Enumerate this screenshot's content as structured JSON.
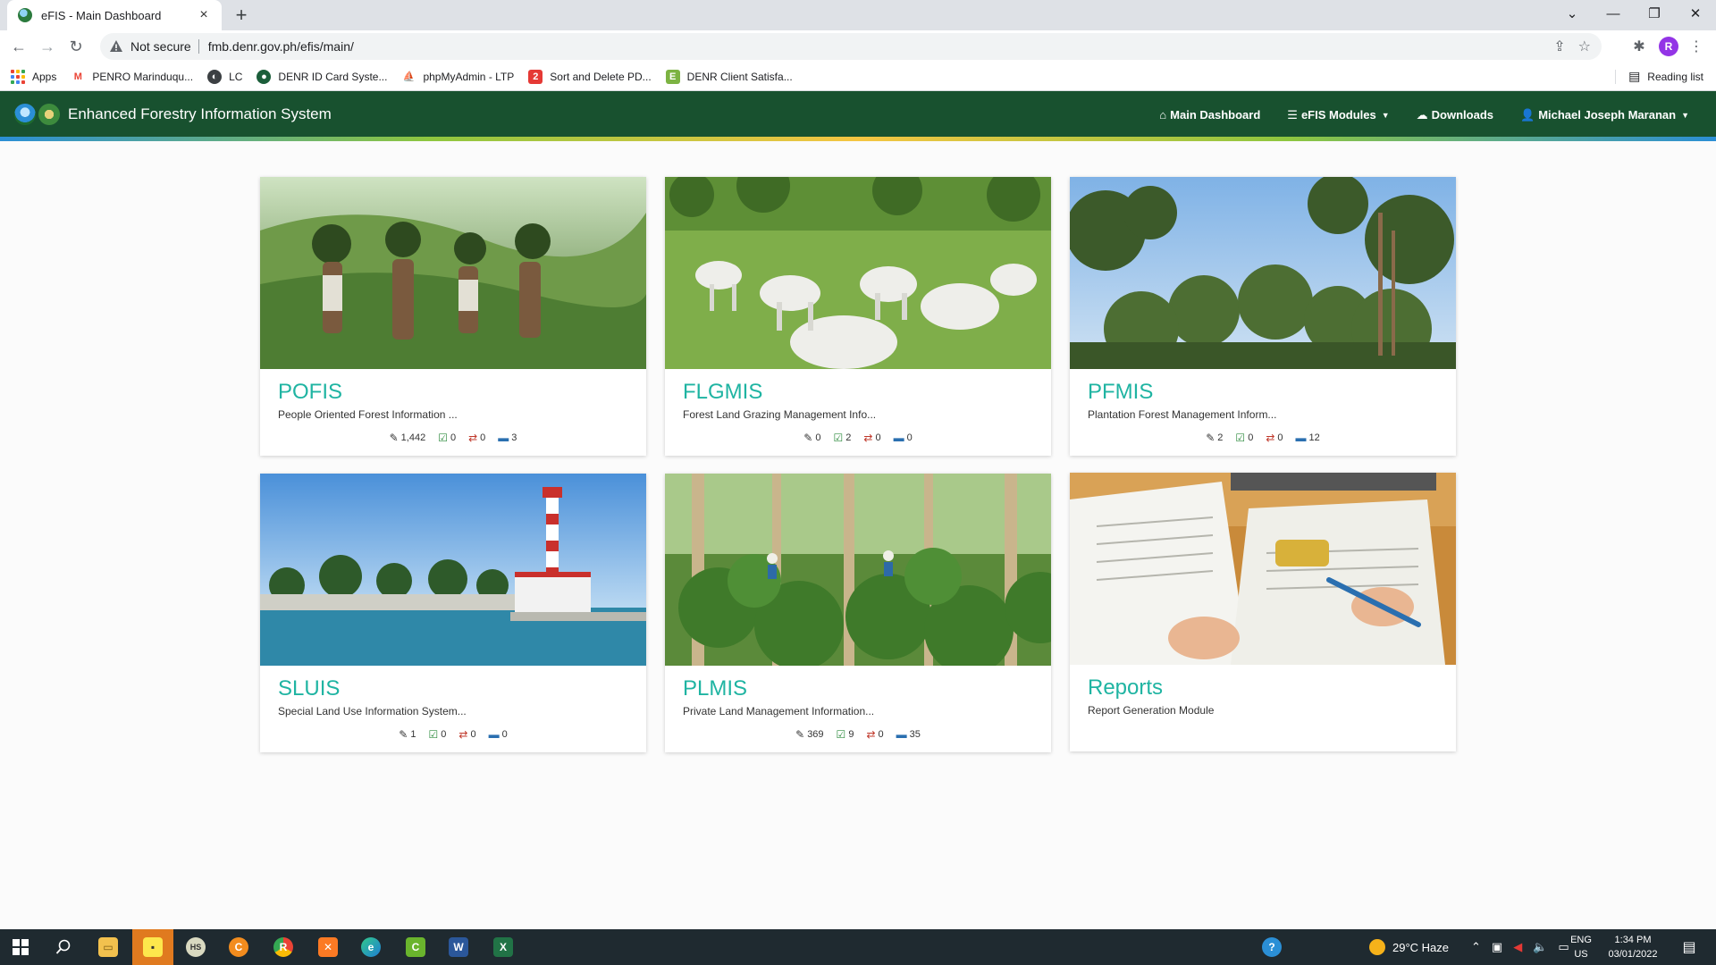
{
  "browser": {
    "tab_title": "eFIS - Main Dashboard",
    "tab_close": "×",
    "new_tab": "+",
    "security_label": "Not secure",
    "url": "fmb.denr.gov.ph/efis/main/",
    "profile_initial": "R",
    "reading_list": "Reading list",
    "icons": [
      "back-icon",
      "forward-icon",
      "reload-icon",
      "share-icon",
      "star-icon",
      "extensions-icon",
      "menu-icon"
    ]
  },
  "bookmarks": [
    {
      "label": "Apps",
      "icon": "apps-icon"
    },
    {
      "label": "PENRO Marinduqu...",
      "icon": "gmail-icon"
    },
    {
      "label": "LC",
      "icon": "lc-icon"
    },
    {
      "label": "DENR ID Card Syste...",
      "icon": "denr-icon"
    },
    {
      "label": "phpMyAdmin - LTP",
      "icon": "phpmyadmin-icon"
    },
    {
      "label": "Sort and Delete PD...",
      "icon": "pdf-icon"
    },
    {
      "label": "DENR Client Satisfa...",
      "icon": "survey-icon"
    }
  ],
  "app": {
    "title": "Enhanced Forestry Information System",
    "nav": {
      "dashboard": "Main Dashboard",
      "modules": "eFIS Modules",
      "downloads": "Downloads",
      "user": "Michael Joseph Maranan"
    }
  },
  "cards": [
    {
      "title": "POFIS",
      "subtitle": "People Oriented Forest Information ...",
      "stats": [
        "1,442",
        "0",
        "0",
        "3"
      ]
    },
    {
      "title": "FLGMIS",
      "subtitle": "Forest Land Grazing Management Info...",
      "stats": [
        "0",
        "2",
        "0",
        "0"
      ]
    },
    {
      "title": "PFMIS",
      "subtitle": "Plantation Forest Management Inform...",
      "stats": [
        "2",
        "0",
        "0",
        "12"
      ]
    },
    {
      "title": "SLUIS",
      "subtitle": "Special Land Use Information System...",
      "stats": [
        "1",
        "0",
        "0",
        "0"
      ]
    },
    {
      "title": "PLMIS",
      "subtitle": "Private Land Management Information...",
      "stats": [
        "369",
        "9",
        "0",
        "35"
      ]
    },
    {
      "title": "Reports",
      "subtitle": "Report Generation Module"
    }
  ],
  "taskbar": {
    "weather": "29°C  Haze",
    "lang_line1": "ENG",
    "lang_line2": "US",
    "time": "1:34 PM",
    "date": "03/01/2022",
    "apps": [
      "windows-start-icon",
      "search-icon",
      "file-explorer-icon",
      "sticky-notes-icon",
      "hs-icon",
      "ccleaner-icon",
      "chrome-icon",
      "xampp-icon",
      "edge-icon",
      "camtasia-icon",
      "word-icon",
      "excel-icon"
    ]
  }
}
